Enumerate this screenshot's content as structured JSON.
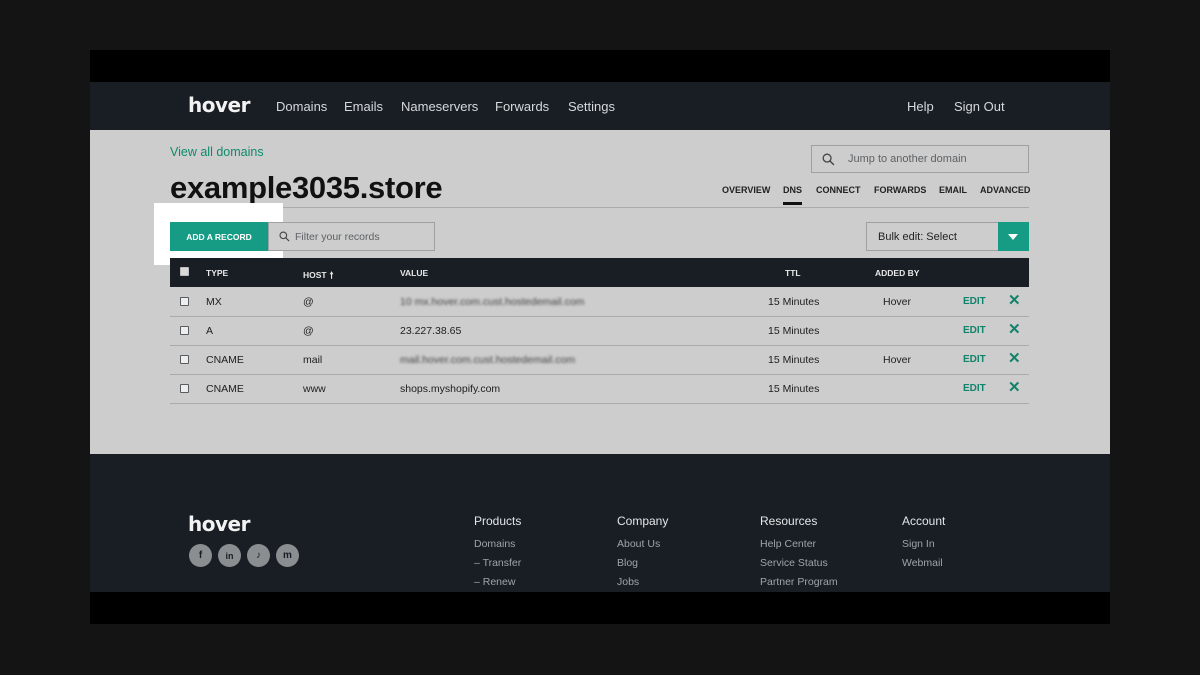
{
  "header": {
    "logo": "hover",
    "nav": [
      "Domains",
      "Emails",
      "Nameservers",
      "Forwards",
      "Settings"
    ],
    "help": "Help",
    "sign_out": "Sign Out"
  },
  "page": {
    "view_all": "View all domains",
    "jump_placeholder": "Jump to another domain",
    "domain": "example3035.store",
    "tabs": [
      "OVERVIEW",
      "DNS",
      "CONNECT",
      "FORWARDS",
      "EMAIL",
      "ADVANCED"
    ],
    "active_tab": "DNS"
  },
  "toolbar": {
    "add_record": "ADD A RECORD",
    "filter_placeholder": "Filter your records",
    "bulk_edit": "Bulk edit: Select"
  },
  "table": {
    "headers": {
      "type": "TYPE",
      "host": "HOST",
      "value": "VALUE",
      "ttl": "TTL",
      "added_by": "ADDED BY"
    },
    "rows": [
      {
        "type": "MX",
        "host": "@",
        "value": "10 mx.hover.com.cust.hostedemail.com",
        "ttl": "15 Minutes",
        "added_by": "Hover",
        "edit": "EDIT"
      },
      {
        "type": "A",
        "host": "@",
        "value": "23.227.38.65",
        "ttl": "15 Minutes",
        "added_by": "",
        "edit": "EDIT"
      },
      {
        "type": "CNAME",
        "host": "mail",
        "value": "mail.hover.com.cust.hostedemail.com",
        "ttl": "15 Minutes",
        "added_by": "Hover",
        "edit": "EDIT"
      },
      {
        "type": "CNAME",
        "host": "www",
        "value": "shops.myshopify.com",
        "ttl": "15 Minutes",
        "added_by": "",
        "edit": "EDIT"
      }
    ]
  },
  "footer": {
    "logo": "hover",
    "social": [
      "f",
      "in",
      "♪",
      "m"
    ],
    "columns": [
      {
        "title": "Products",
        "links": [
          "Domains",
          "–  Transfer",
          "–  Renew"
        ]
      },
      {
        "title": "Company",
        "links": [
          "About Us",
          "Blog",
          "Jobs"
        ]
      },
      {
        "title": "Resources",
        "links": [
          "Help Center",
          "Service Status",
          "Partner Program"
        ]
      },
      {
        "title": "Account",
        "links": [
          "Sign In",
          "Webmail"
        ]
      }
    ]
  }
}
